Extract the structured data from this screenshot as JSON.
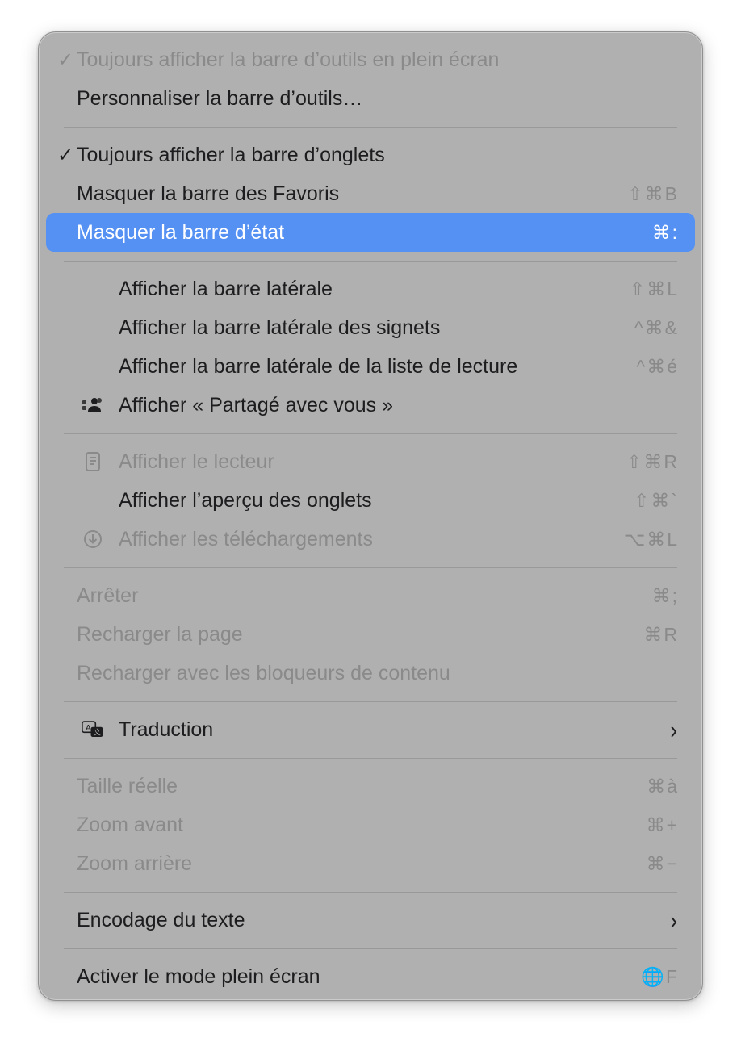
{
  "menu": {
    "groups": [
      [
        {
          "id": "always-show-toolbar-fullscreen",
          "label": "Toujours afficher la barre d’outils en plein écran",
          "check": "✓",
          "disabled": true
        },
        {
          "id": "customize-toolbar",
          "label": "Personnaliser la barre d’outils…"
        }
      ],
      [
        {
          "id": "always-show-tab-bar",
          "label": "Toujours afficher la barre d’onglets",
          "check": "✓"
        },
        {
          "id": "hide-favorites-bar",
          "label": "Masquer la barre des Favoris",
          "shortcut": "⇧⌘B"
        },
        {
          "id": "hide-status-bar",
          "label": "Masquer la barre d’état",
          "shortcut": "⌘:",
          "highlighted": true
        }
      ],
      [
        {
          "id": "show-sidebar",
          "label": "Afficher la barre latérale",
          "shortcut": "⇧⌘L",
          "indent": true
        },
        {
          "id": "show-bookmarks-sidebar",
          "label": "Afficher la barre latérale des signets",
          "shortcut": "^⌘&",
          "indent": true
        },
        {
          "id": "show-reading-list-sidebar",
          "label": "Afficher la barre latérale de la liste de lecture",
          "shortcut": "^⌘é",
          "indent": true
        },
        {
          "id": "show-shared-with-you",
          "label": "Afficher « Partagé avec vous »",
          "icon": "shared-with-you-icon",
          "indent": true
        }
      ],
      [
        {
          "id": "show-reader",
          "label": "Afficher le lecteur",
          "shortcut": "⇧⌘R",
          "icon": "reader-icon",
          "indent": true,
          "disabled": true
        },
        {
          "id": "show-tab-overview",
          "label": "Afficher l’aperçu des onglets",
          "shortcut": "⇧⌘`",
          "indent": true
        },
        {
          "id": "show-downloads",
          "label": "Afficher les téléchargements",
          "shortcut": "⌥⌘L",
          "icon": "download-icon",
          "indent": true,
          "disabled": true
        }
      ],
      [
        {
          "id": "stop",
          "label": "Arrêter",
          "shortcut": "⌘;",
          "disabled": true
        },
        {
          "id": "reload-page",
          "label": "Recharger la page",
          "shortcut": "⌘R",
          "disabled": true
        },
        {
          "id": "reload-without-content-blockers",
          "label": "Recharger avec les bloqueurs de contenu",
          "disabled": true
        }
      ],
      [
        {
          "id": "translation",
          "label": "Traduction",
          "icon": "translate-icon",
          "indent": true,
          "submenu": true
        }
      ],
      [
        {
          "id": "actual-size",
          "label": "Taille réelle",
          "shortcut": "⌘à",
          "disabled": true
        },
        {
          "id": "zoom-in",
          "label": "Zoom avant",
          "shortcut": "⌘+",
          "disabled": true
        },
        {
          "id": "zoom-out",
          "label": "Zoom arrière",
          "shortcut": "⌘−",
          "disabled": true
        }
      ],
      [
        {
          "id": "text-encoding",
          "label": "Encodage du texte",
          "submenu": true
        }
      ],
      [
        {
          "id": "enter-full-screen",
          "label": "Activer le mode plein écran",
          "shortcut": "🌐F"
        }
      ]
    ],
    "submenu_glyph": "›"
  },
  "colors": {
    "menu_background": "#b0b0b0",
    "highlight": "#5590f3",
    "text": "#1d1d1f",
    "disabled_text": "#8a8a8a"
  }
}
